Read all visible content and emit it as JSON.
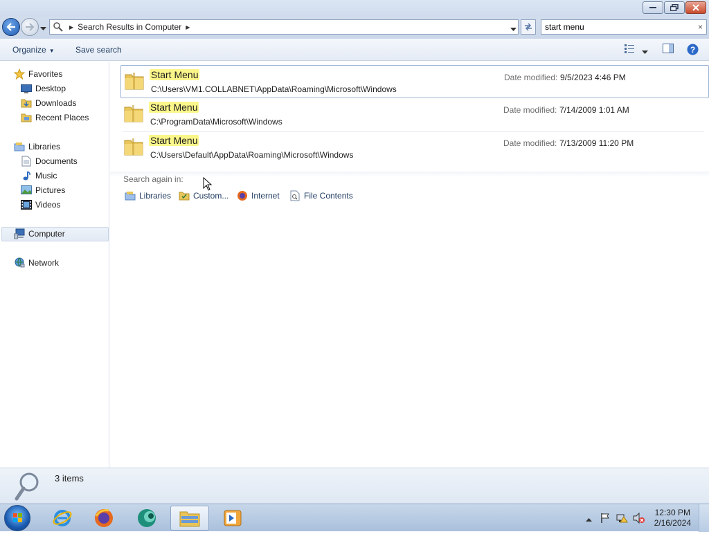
{
  "window": {
    "minimize": "minimize",
    "maximize": "maximize",
    "close": "close"
  },
  "address": {
    "breadcrumb": "Search Results in Computer"
  },
  "search": {
    "value": "start menu",
    "clear": "×"
  },
  "toolbar": {
    "organize": "Organize",
    "save_search": "Save search"
  },
  "nav": {
    "favorites": "Favorites",
    "desktop": "Desktop",
    "downloads": "Downloads",
    "recent_places": "Recent Places",
    "libraries": "Libraries",
    "documents": "Documents",
    "music": "Music",
    "pictures": "Pictures",
    "videos": "Videos",
    "computer": "Computer",
    "network": "Network"
  },
  "results": [
    {
      "name": "Start Menu",
      "path": "C:\\Users\\VM1.COLLABNET\\AppData\\Roaming\\Microsoft\\Windows",
      "date_label": "Date modified:",
      "date": "9/5/2023 4:46 PM"
    },
    {
      "name": "Start Menu",
      "path": "C:\\ProgramData\\Microsoft\\Windows",
      "date_label": "Date modified:",
      "date": "7/14/2009 1:01 AM"
    },
    {
      "name": "Start Menu",
      "path": "C:\\Users\\Default\\AppData\\Roaming\\Microsoft\\Windows",
      "date_label": "Date modified:",
      "date": "7/13/2009 11:20 PM"
    }
  ],
  "search_again": {
    "label": "Search again in:",
    "links": [
      "Libraries",
      "Custom...",
      "Internet",
      "File Contents"
    ]
  },
  "details": {
    "count": "3 items"
  },
  "taskbar": {
    "time": "12:30 PM",
    "date": "2/16/2024"
  }
}
